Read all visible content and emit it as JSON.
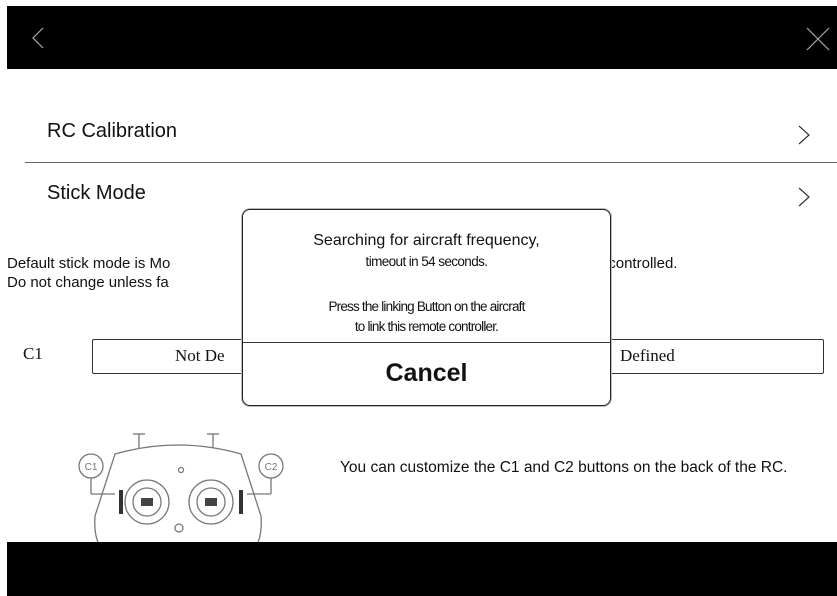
{
  "header": {
    "back_icon": "chevron-left-icon",
    "close_icon": "close-icon"
  },
  "menu": {
    "items": [
      {
        "label": "RC Calibration",
        "icon": "chevron-right-icon"
      },
      {
        "label": "Stick Mode",
        "icon": "chevron-right-icon"
      }
    ]
  },
  "description": {
    "line1_left": "Default stick mode is Mo",
    "line1_right": "he aircraft is controlled.",
    "line2_left": "Do not change unless fa"
  },
  "custom_buttons": {
    "c1_label": "C1",
    "c1_value": "Not De",
    "c2_value": "Defined",
    "note": "You can customize the C1 and C2 buttons on the back of the RC.",
    "image_c1": "C1",
    "image_c2": "C2"
  },
  "dialog": {
    "message_line1": "Searching for aircraft frequency,",
    "message_line2": "timeout  in 54 seconds.",
    "message_line3": "Press the linking Button on the aircraft",
    "message_line4": "to link this remote controller.",
    "cancel_label": "Cancel"
  },
  "colors": {
    "bar": "#000000",
    "background": "#ffffff",
    "text": "#111111"
  }
}
